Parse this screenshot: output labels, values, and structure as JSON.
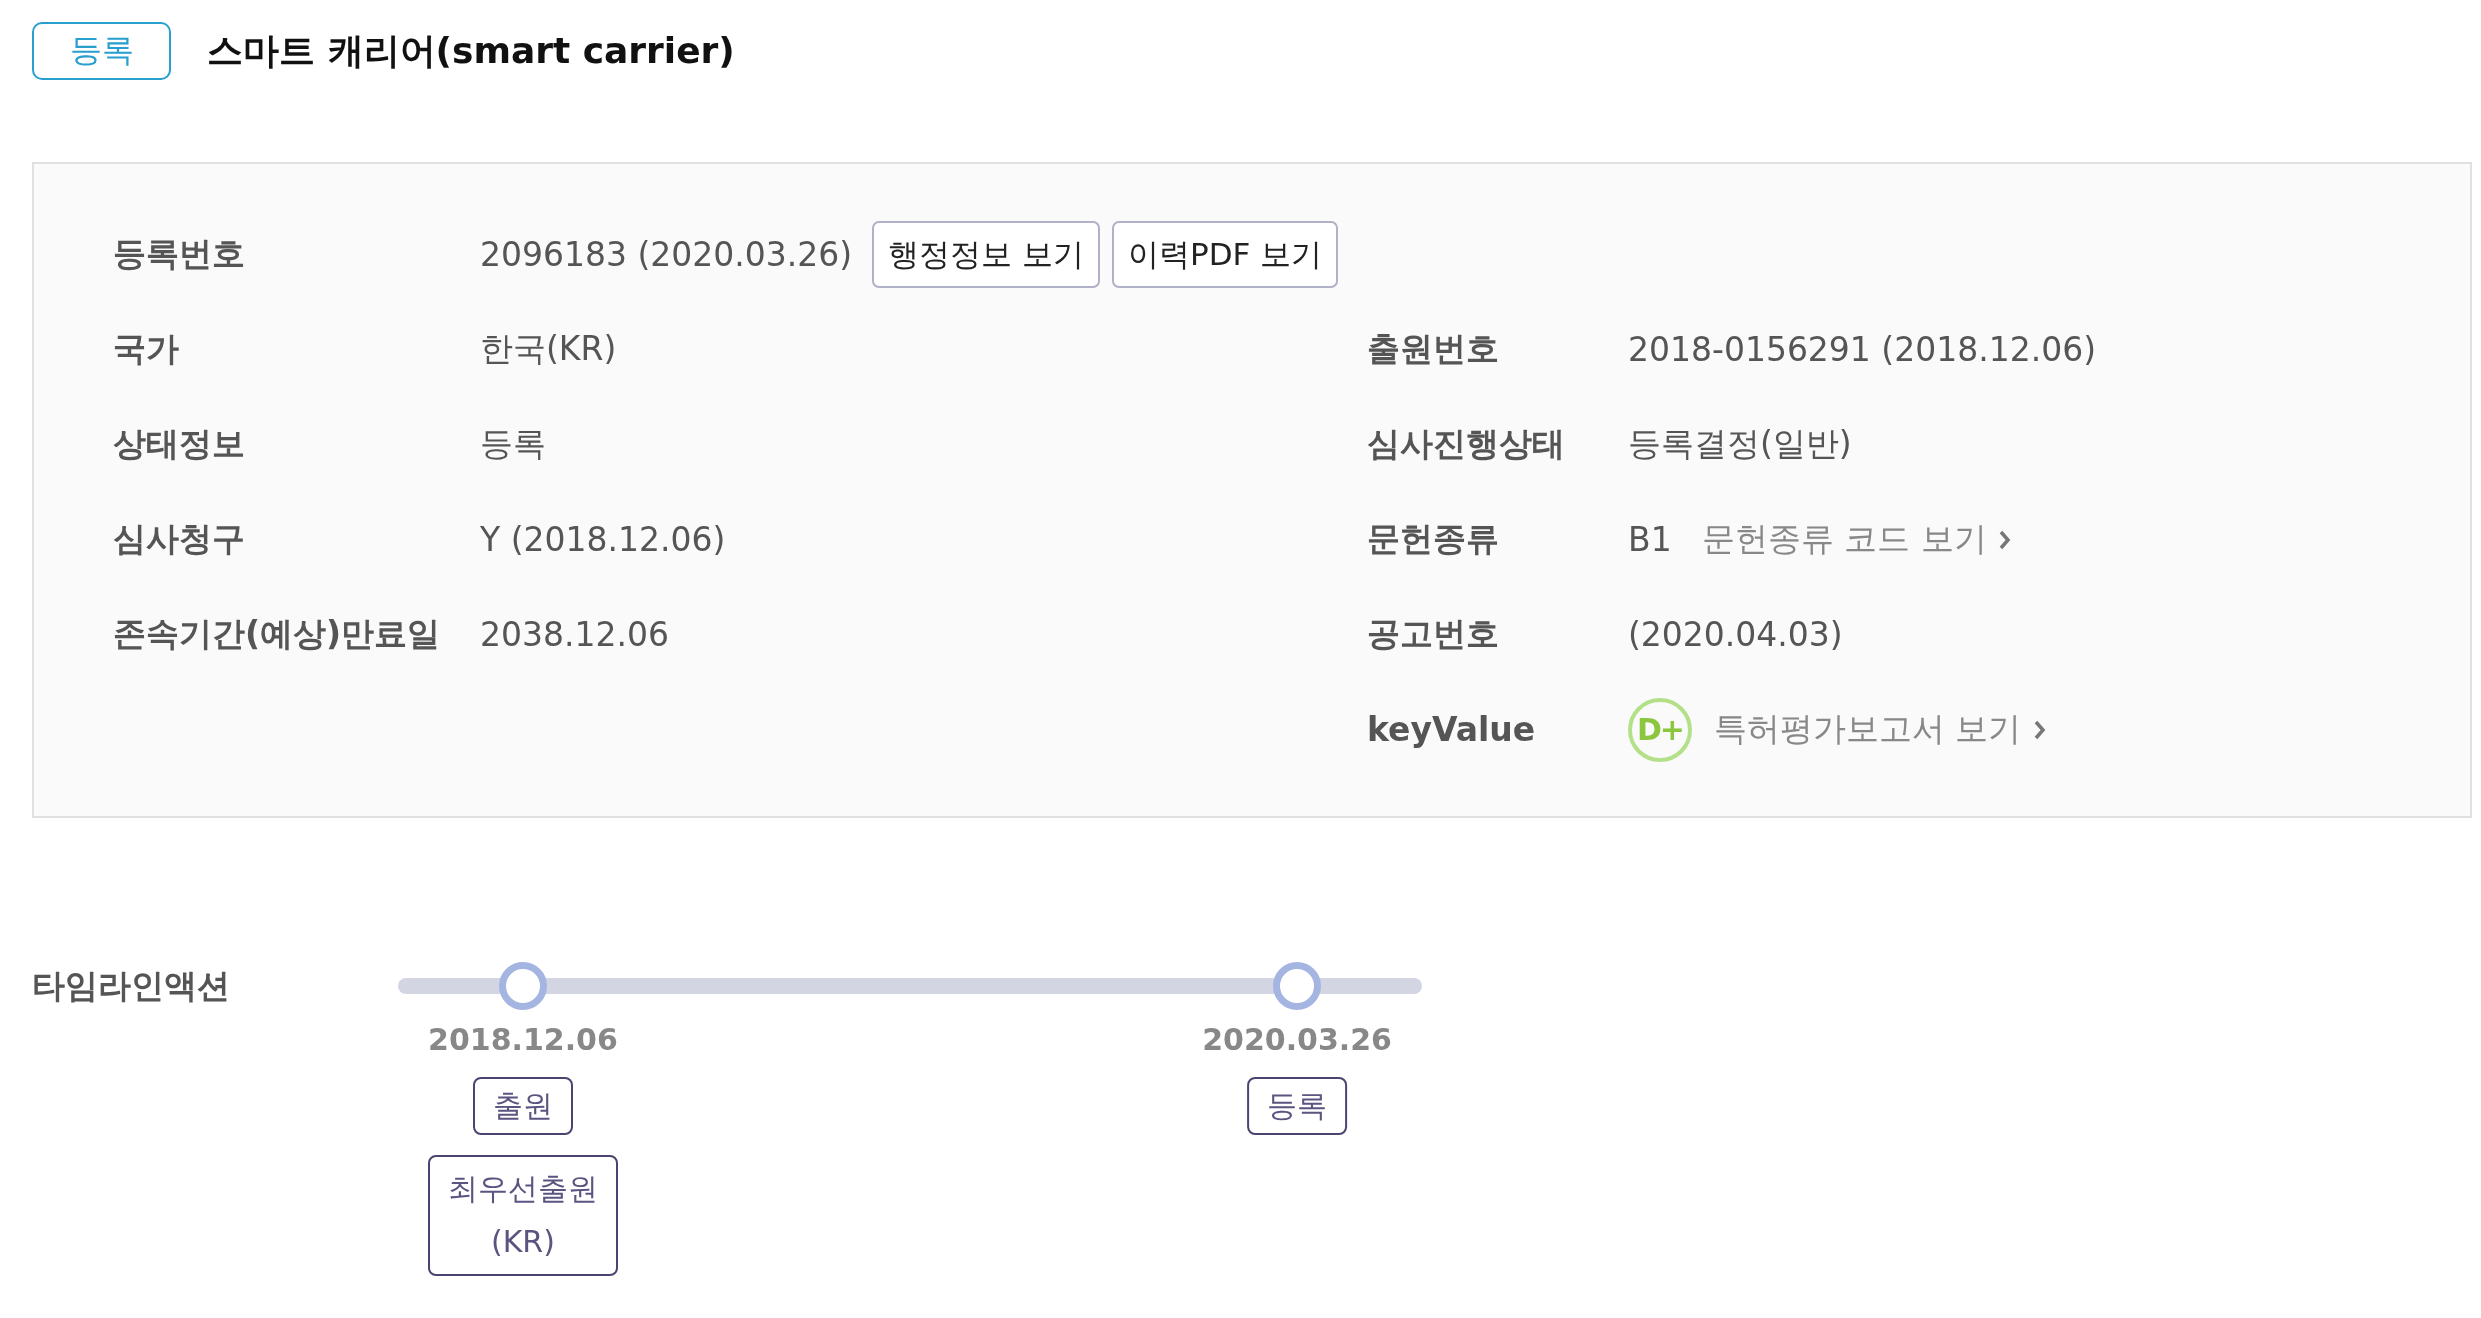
{
  "header": {
    "status_badge": "등록",
    "title": "스마트 캐리어(smart carrier)"
  },
  "info": {
    "left_fields": [
      {
        "kind": "text",
        "label": "등록번호",
        "value": "2096183 (2020.03.26)",
        "buttons": [
          "행정정보 보기",
          "이력PDF 보기"
        ]
      },
      {
        "kind": "text",
        "label": "국가",
        "value": "한국(KR)"
      },
      {
        "kind": "text",
        "label": "상태정보",
        "value": "등록"
      },
      {
        "kind": "text",
        "label": "심사청구",
        "value": "Y (2018.12.06)"
      },
      {
        "kind": "text",
        "label": "존속기간(예상)만료일",
        "value": "2038.12.06"
      }
    ],
    "right_fields": [
      {
        "kind": "text",
        "label": "출원번호",
        "value": "2018-0156291 (2018.12.06)"
      },
      {
        "kind": "text",
        "label": "심사진행상태",
        "value": "등록결정(일반)"
      },
      {
        "kind": "code_link",
        "label": "문헌종류",
        "value": "B1",
        "link": "문헌종류 코드 보기"
      },
      {
        "kind": "text",
        "label": "공고번호",
        "value": "(2020.04.03)"
      },
      {
        "kind": "grade_link",
        "label": "keyValue",
        "grade": "D+",
        "link": "특허평가보고서 보기"
      }
    ]
  },
  "timeline": {
    "label": "타임라인액션",
    "events": [
      {
        "date": "2018.12.06",
        "tags": [
          "출원",
          "최우선출원\n(KR)"
        ]
      },
      {
        "date": "2020.03.26",
        "tags": [
          "등록"
        ]
      }
    ]
  }
}
